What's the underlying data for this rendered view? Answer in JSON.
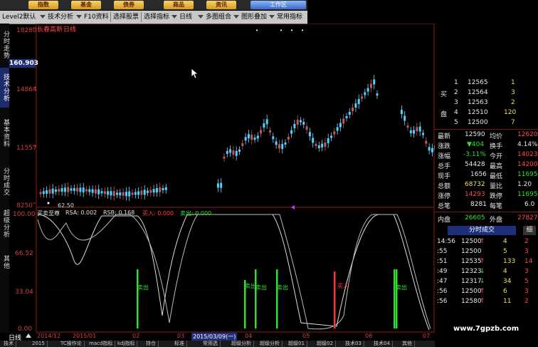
{
  "topbar": {
    "buttons": [
      "指数",
      "基金",
      "债券",
      "商品",
      "资讯"
    ],
    "work_area": "工作区"
  },
  "menubar": {
    "items": [
      "Level2默认",
      "技术分析",
      "F10资料",
      "选择股票",
      "选择指标",
      "日线",
      "多图组合",
      "图形叠加",
      "常用指标"
    ]
  },
  "left_tabs": [
    "分时走势",
    "技术分析",
    "基本资料",
    "分时成交",
    "超级分析",
    "其他"
  ],
  "chart": {
    "title": "长春高新",
    "period_label": "日线",
    "price_labels": [
      "18280",
      "14864",
      "11557",
      "8250"
    ],
    "current_price_box": "160.903",
    "low_marker": "62.50",
    "indicator_title": "买卖至尊",
    "indicator_params": [
      "RSA: 0.002",
      "RSB: 0.168",
      "买入: 0.000",
      "卖出: 0.000"
    ],
    "indicator_levels": [
      "100.00",
      "66.52",
      "33.04",
      "0.00"
    ],
    "signal_labels": [
      "卖出",
      "卖出",
      "卖出",
      "卖出",
      "买入",
      "卖出"
    ],
    "date_labels": [
      "2014/12",
      "2015/01",
      "02",
      "03",
      "2015/03/09(一)",
      "04",
      "05",
      "06",
      "07"
    ]
  },
  "order_book": {
    "sell": [
      {
        "label": "",
        "level": "1",
        "price": "12565",
        "vol": "1"
      },
      {
        "label": "买",
        "level": "2",
        "price": "12564",
        "vol": "3"
      },
      {
        "label": "",
        "level": "3",
        "price": "12563",
        "vol": "2"
      },
      {
        "label": "盘",
        "level": "4",
        "price": "12510",
        "vol": "120"
      },
      {
        "label": "",
        "level": "5",
        "price": "12500",
        "vol": "7"
      }
    ]
  },
  "quote": [
    {
      "k1": "最新",
      "v1": "12590",
      "k2": "均价",
      "v2": "12620"
    },
    {
      "k1": "涨跌",
      "v1": "▼404",
      "k2": "换手",
      "v2": "4.14%"
    },
    {
      "k1": "涨幅",
      "v1": "-3.11%",
      "k2": "今开",
      "v2": "14023"
    },
    {
      "k1": "总手",
      "v1": "54428",
      "k2": "最高",
      "v2": "14200"
    },
    {
      "k1": "现手",
      "v1": "1656",
      "k2": "最低",
      "v2": "11695"
    },
    {
      "k1": "总额",
      "v1": "68732",
      "k2": "量比",
      "v2": "1.20"
    },
    {
      "k1": "涨停",
      "v1": "14293",
      "k2": "跌停",
      "v2": "11695"
    },
    {
      "k1": "总笔",
      "v1": "8281",
      "k2": "每笔",
      "v2": "6.0"
    }
  ],
  "inout": {
    "k1": "内盘",
    "v1": "26605",
    "k2": "外盘",
    "v2": "27827"
  },
  "trade_tab": {
    "label": "分时成交",
    "extra": "细"
  },
  "trades": [
    {
      "t": "14:56",
      "p": "12500",
      "d": "↑",
      "v": "4",
      "n": "2"
    },
    {
      "t": ":55",
      "p": "12500",
      "d": "",
      "v": "5",
      "n": "3"
    },
    {
      "t": ":51",
      "p": "12535",
      "d": "↑",
      "v": "133",
      "n": "14"
    },
    {
      "t": ":49",
      "p": "12323",
      "d": "↓",
      "v": "4",
      "n": "3"
    },
    {
      "t": ":47",
      "p": "12317",
      "d": "↓",
      "v": "34",
      "n": "5"
    },
    {
      "t": ":56",
      "p": "12500",
      "d": "↑",
      "v": "6",
      "n": "3"
    },
    {
      "t": ":56",
      "p": "12580",
      "d": "↑",
      "v": "11",
      "n": "2"
    }
  ],
  "bottom": {
    "left_label": "日线",
    "tabs": [
      "技术",
      "2015",
      "TC操作论",
      "macd指标",
      "kdj指标",
      "持仓",
      "标准",
      "常用选",
      "超级分析",
      "超级分析",
      "超级01",
      "超级02",
      "技术03",
      "技术04",
      "其他"
    ]
  },
  "watermark": "www.7gpzb.com"
}
